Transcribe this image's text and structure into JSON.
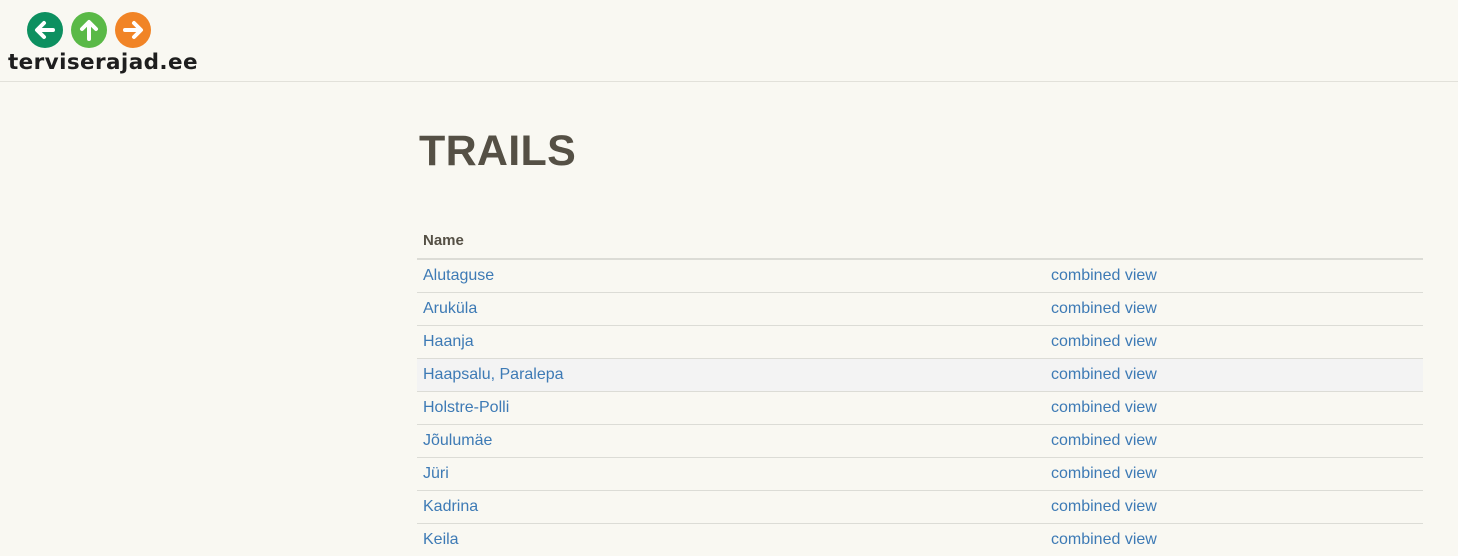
{
  "logo": {
    "text": "terviserajad.ee",
    "circles": [
      {
        "icon": "arrow-left-icon",
        "color": "#0d9060"
      },
      {
        "icon": "arrow-up-icon",
        "color": "#5ab947"
      },
      {
        "icon": "arrow-right-icon",
        "color": "#f18426"
      }
    ]
  },
  "page": {
    "title": "TRAILS"
  },
  "table": {
    "header": {
      "name": "Name",
      "action": ""
    },
    "rows": [
      {
        "name": "Alutaguse",
        "action": "combined view"
      },
      {
        "name": "Aruküla",
        "action": "combined view"
      },
      {
        "name": "Haanja",
        "action": "combined view"
      },
      {
        "name": "Haapsalu, Paralepa",
        "action": "combined view"
      },
      {
        "name": "Holstre-Polli",
        "action": "combined view"
      },
      {
        "name": "Jõulumäe",
        "action": "combined view"
      },
      {
        "name": "Jüri",
        "action": "combined view"
      },
      {
        "name": "Kadrina",
        "action": "combined view"
      },
      {
        "name": "Keila",
        "action": "combined view"
      }
    ]
  },
  "colors": {
    "background": "#f9f8f2",
    "link": "#3d7ab5",
    "title": "#555045"
  }
}
